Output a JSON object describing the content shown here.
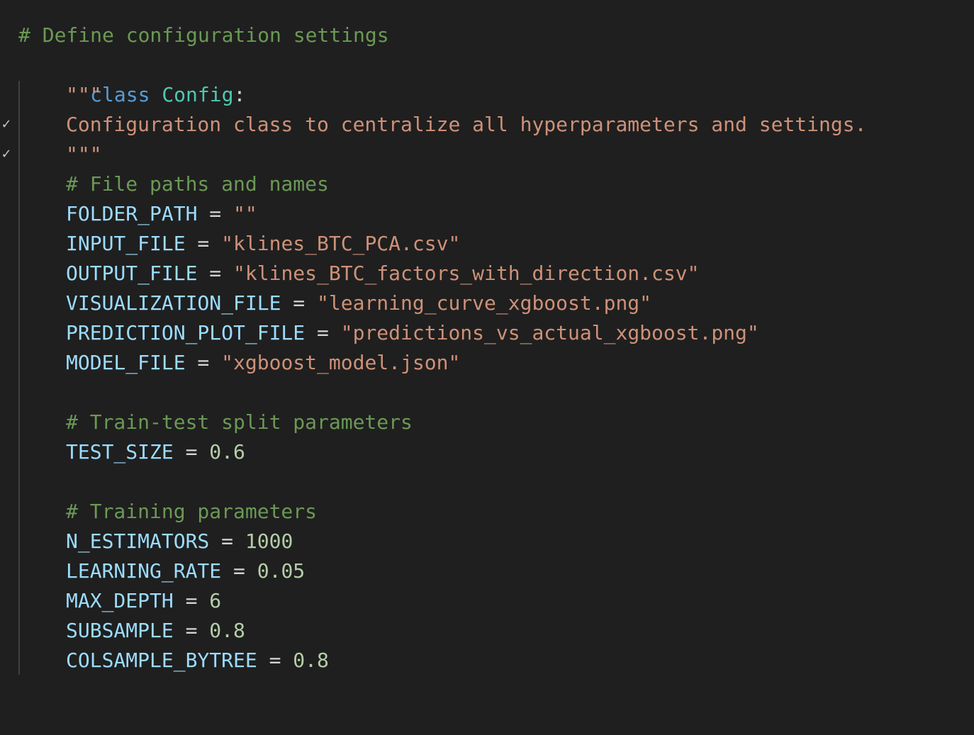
{
  "editor": {
    "lines": [
      {
        "comment": "# Define configuration settings"
      },
      {
        "keyword": "class",
        "class_name": "Config",
        "colon": ":"
      },
      {
        "docstring_open": "\"\"\""
      },
      {
        "docstring": "Configuration class to centralize all hyperparameters and settings."
      },
      {
        "docstring_close": "\"\"\""
      },
      {
        "comment": "# File paths and names"
      },
      {
        "var": "FOLDER_PATH",
        "op": " = ",
        "value": "\"\""
      },
      {
        "var": "INPUT_FILE",
        "op": " = ",
        "value": "\"klines_BTC_PCA.csv\""
      },
      {
        "var": "OUTPUT_FILE",
        "op": " = ",
        "value": "\"klines_BTC_factors_with_direction.csv\""
      },
      {
        "var": "VISUALIZATION_FILE",
        "op": " = ",
        "value": "\"learning_curve_xgboost.png\""
      },
      {
        "var": "PREDICTION_PLOT_FILE",
        "op": " = ",
        "value": "\"predictions_vs_actual_xgboost.png\""
      },
      {
        "var": "MODEL_FILE",
        "op": " = ",
        "value": "\"xgboost_model.json\""
      },
      {
        "comment": "# Train-test split parameters"
      },
      {
        "var": "TEST_SIZE",
        "op": " = ",
        "value": "0.6"
      },
      {
        "comment": "# Training parameters"
      },
      {
        "var": "N_ESTIMATORS",
        "op": " = ",
        "value": "1000"
      },
      {
        "var": "LEARNING_RATE",
        "op": " = ",
        "value": "0.05"
      },
      {
        "var": "MAX_DEPTH",
        "op": " = ",
        "value": "6"
      },
      {
        "var": "SUBSAMPLE",
        "op": " = ",
        "value": "0.8"
      },
      {
        "var": "COLSAMPLE_BYTREE",
        "op": " = ",
        "value": "0.8"
      }
    ],
    "fold_icons": [
      "chevron-down-icon",
      "chevron-down-icon"
    ],
    "colors": {
      "background": "#1f1f1f",
      "keyword": "#569cd6",
      "class_name": "#4ec9b0",
      "comment": "#6a9955",
      "string": "#ce9178",
      "variable": "#9cdcfe",
      "number": "#b5cea8"
    }
  }
}
